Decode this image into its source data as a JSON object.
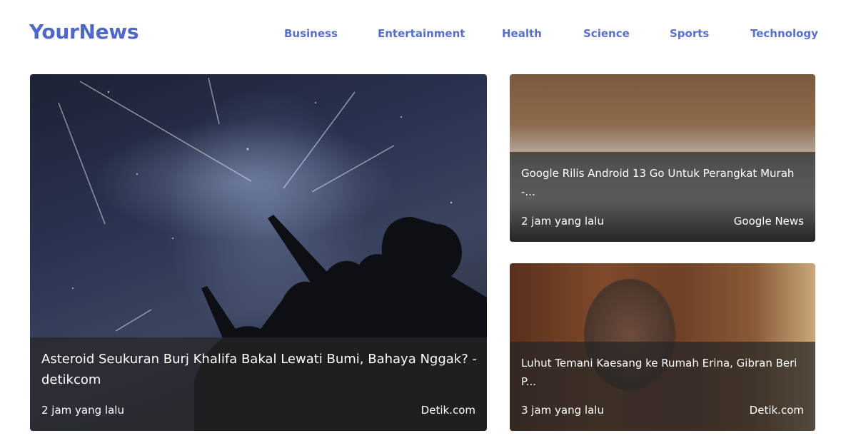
{
  "header": {
    "logo": "YourNews",
    "nav": [
      "Business",
      "Entertainment",
      "Health",
      "Science",
      "Sports",
      "Technology"
    ]
  },
  "cards": [
    {
      "title": "Asteroid Seukuran Burj Khalifa Bakal Lewati Bumi, Bahaya Nggak? - detikcom",
      "time": "2 jam yang lalu",
      "source": "Detik.com"
    },
    {
      "title": "Google Rilis Android 13 Go Untuk Perangkat Murah -...",
      "time": "2 jam yang lalu",
      "source": "Google News"
    },
    {
      "title": "Luhut Temani Kaesang ke Rumah Erina, Gibran Beri P...",
      "time": "3 jam yang lalu",
      "source": "Detik.com"
    }
  ],
  "colors": {
    "brand": "#4f68c9",
    "nav": "#5870cc",
    "overlay": "rgba(38,38,38,0.72)"
  }
}
